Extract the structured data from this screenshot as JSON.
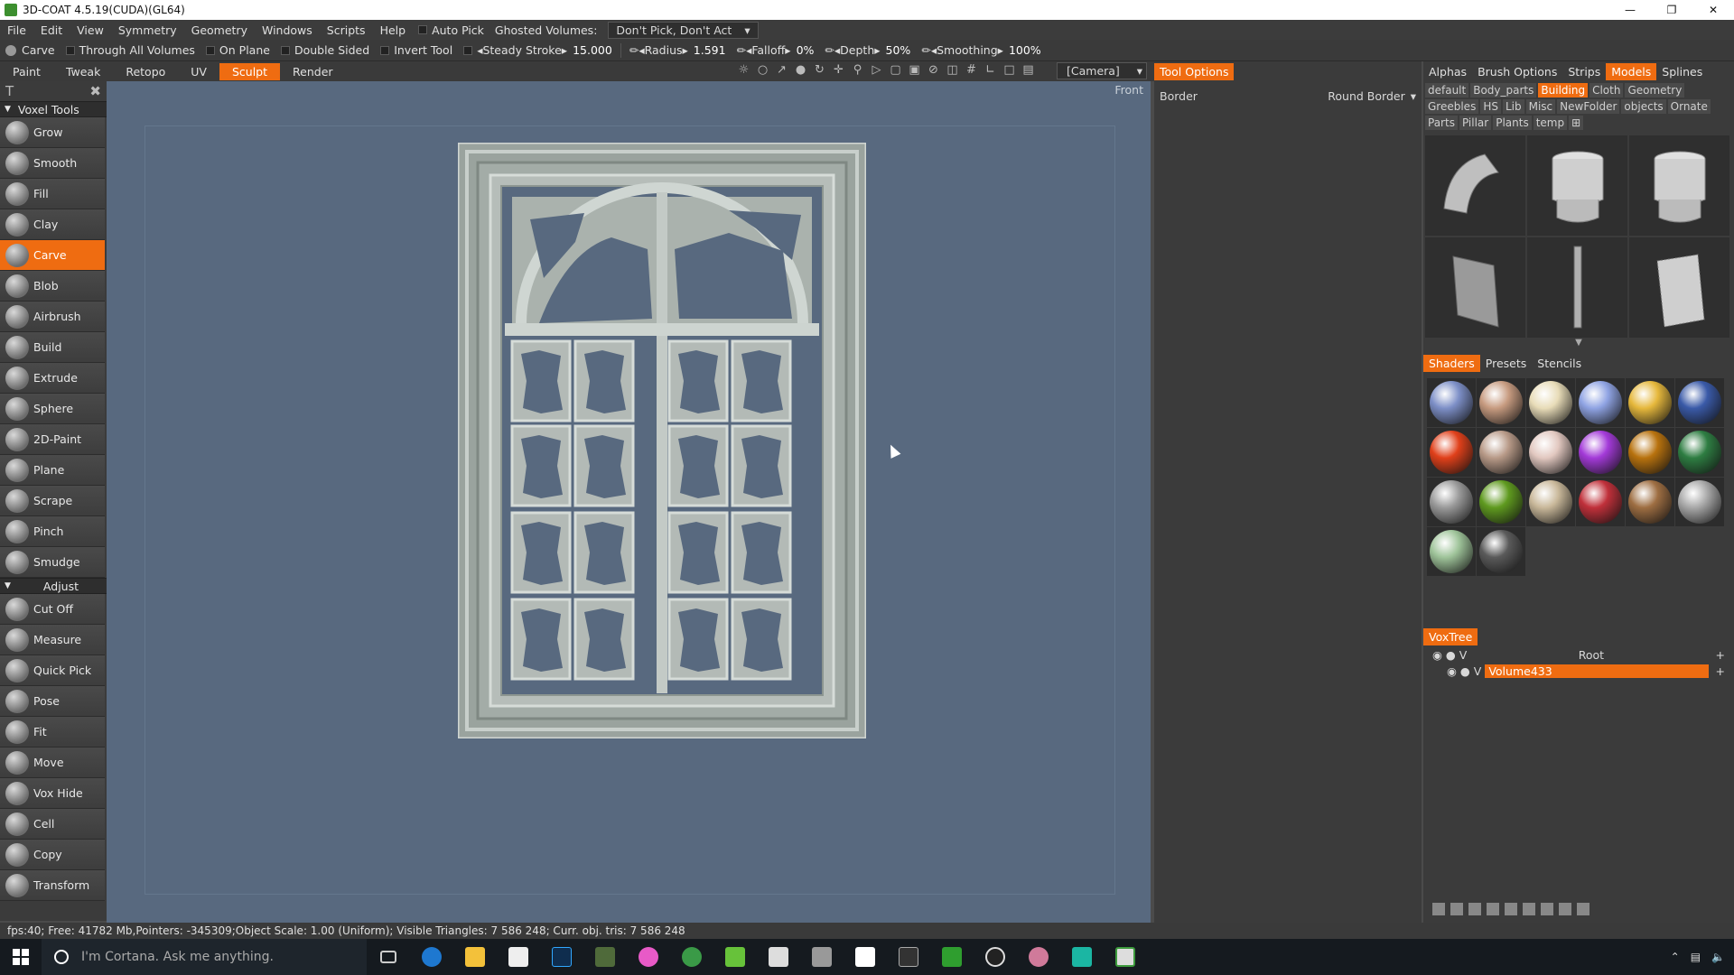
{
  "window": {
    "title": "3D-COAT 4.5.19(CUDA)(GL64)"
  },
  "menu": [
    "File",
    "Edit",
    "View",
    "Symmetry",
    "Geometry",
    "Windows",
    "Scripts",
    "Help"
  ],
  "menu_extra": {
    "auto_pick": "Auto Pick",
    "ghosted_label": "Ghosted Volumes:",
    "ghosted_value": "Don't Pick, Don't Act"
  },
  "toolbar": {
    "tool_name": "Carve",
    "through_all": "Through All Volumes",
    "on_plane": "On Plane",
    "double_sided": "Double Sided",
    "invert_tool": "Invert Tool",
    "steady_stroke": "Steady Stroke",
    "steady_value": "15.000",
    "radius_label": "Radius",
    "radius_value": "1.591",
    "falloff_label": "Falloff",
    "falloff_value": "0%",
    "depth_label": "Depth",
    "depth_value": "50%",
    "smoothing_label": "Smoothing",
    "smoothing_value": "100%"
  },
  "rooms": [
    {
      "label": "Paint",
      "active": false
    },
    {
      "label": "Tweak",
      "active": false
    },
    {
      "label": "Retopo",
      "active": false
    },
    {
      "label": "UV",
      "active": false
    },
    {
      "label": "Sculpt",
      "active": true
    },
    {
      "label": "Render",
      "active": false
    }
  ],
  "camera_dropdown": "[Camera]",
  "viewport": {
    "view_label": "Front"
  },
  "left_panel": {
    "voxel_section": "Voxel Tools",
    "voxel_tools": [
      "Grow",
      "Smooth",
      "Fill",
      "Clay",
      "Carve",
      "Blob",
      "Airbrush",
      "Build",
      "Extrude",
      "Sphere",
      "2D-Paint",
      "Plane",
      "Scrape",
      "Pinch",
      "Smudge"
    ],
    "active_tool": "Carve",
    "adjust_section": "Adjust",
    "adjust_tools": [
      "Cut Off",
      "Measure",
      "Quick Pick",
      "Pose",
      "Fit",
      "Move",
      "Vox Hide",
      "Cell",
      "Copy",
      "Transform"
    ]
  },
  "tool_options": {
    "tab": "Tool Options",
    "border_label": "Border",
    "border_value": "Round Border"
  },
  "right_panel": {
    "tabs": [
      {
        "label": "Alphas",
        "active": false
      },
      {
        "label": "Brush Options",
        "active": false
      },
      {
        "label": "Strips",
        "active": false
      },
      {
        "label": "Models",
        "active": true
      },
      {
        "label": "Splines",
        "active": false
      }
    ],
    "categories": [
      {
        "label": "default",
        "active": false
      },
      {
        "label": "Body_parts",
        "active": false
      },
      {
        "label": "Building",
        "active": true
      },
      {
        "label": "Cloth",
        "active": false
      },
      {
        "label": "Geometry",
        "active": false
      },
      {
        "label": "Greebles",
        "active": false
      },
      {
        "label": "HS",
        "active": false
      },
      {
        "label": "Lib",
        "active": false
      },
      {
        "label": "Misc",
        "active": false
      },
      {
        "label": "NewFolder",
        "active": false
      },
      {
        "label": "objects",
        "active": false
      },
      {
        "label": "Ornate",
        "active": false
      },
      {
        "label": "Parts",
        "active": false
      },
      {
        "label": "Pillar",
        "active": false
      },
      {
        "label": "Plants",
        "active": false
      },
      {
        "label": "temp",
        "active": false
      }
    ],
    "shader_tabs": [
      {
        "label": "Shaders",
        "active": true
      },
      {
        "label": "Presets",
        "active": false
      },
      {
        "label": "Stencils",
        "active": false
      }
    ],
    "shader_colors": [
      "#7d8fc7",
      "#c79b80",
      "#e8dcb8",
      "#8fa3e3",
      "#e6b83c",
      "#3a5aa8",
      "#e0401a",
      "#b89a88",
      "#e2c8c0",
      "#a33ad8",
      "#b8720e",
      "#2e7d42",
      "#9a9a9a",
      "#5f9a1f",
      "#c9b89a",
      "#c0303a",
      "#9e6e42",
      "#a8a8a8",
      "#9fc49a",
      "#5a5a5a"
    ],
    "voxtree_tab": "VoxTree",
    "voxtree_root": "Root",
    "voxtree_item": "Volume433"
  },
  "status": "fps:40;   Free: 41782 Mb,Pointers: -345309;Object Scale: 1.00 (Uniform); Visible Triangles: 7 586 248; Curr. obj. tris: 7 586 248",
  "taskbar": {
    "cortana": "I'm Cortana. Ask me anything."
  },
  "colors": {
    "accent": "#ef6c11",
    "viewport": "#58697f"
  }
}
